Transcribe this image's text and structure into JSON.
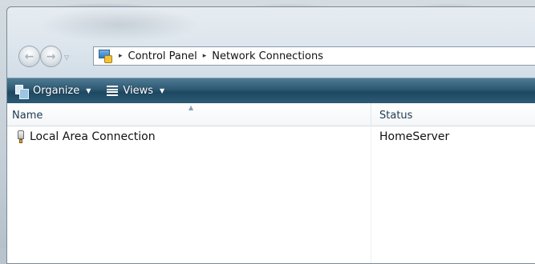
{
  "address_bar": {
    "crumbs": [
      "Control Panel",
      "Network Connections"
    ],
    "separator": "▸",
    "icon": "control-panel-icon"
  },
  "navigation": {
    "back_icon": "back-arrow-icon",
    "forward_icon": "forward-arrow-icon",
    "history_icon": "chevron-down-icon"
  },
  "toolbar": {
    "organize_label": "Organize",
    "views_label": "Views",
    "dropdown_glyph": "▼",
    "background_color": "#2d5872"
  },
  "table": {
    "columns": [
      "Name",
      "Status"
    ],
    "sort_indicator": "▲",
    "rows": [
      {
        "name": "Local Area Connection",
        "status": "HomeServer",
        "icon": "network-adapter-icon"
      }
    ]
  }
}
